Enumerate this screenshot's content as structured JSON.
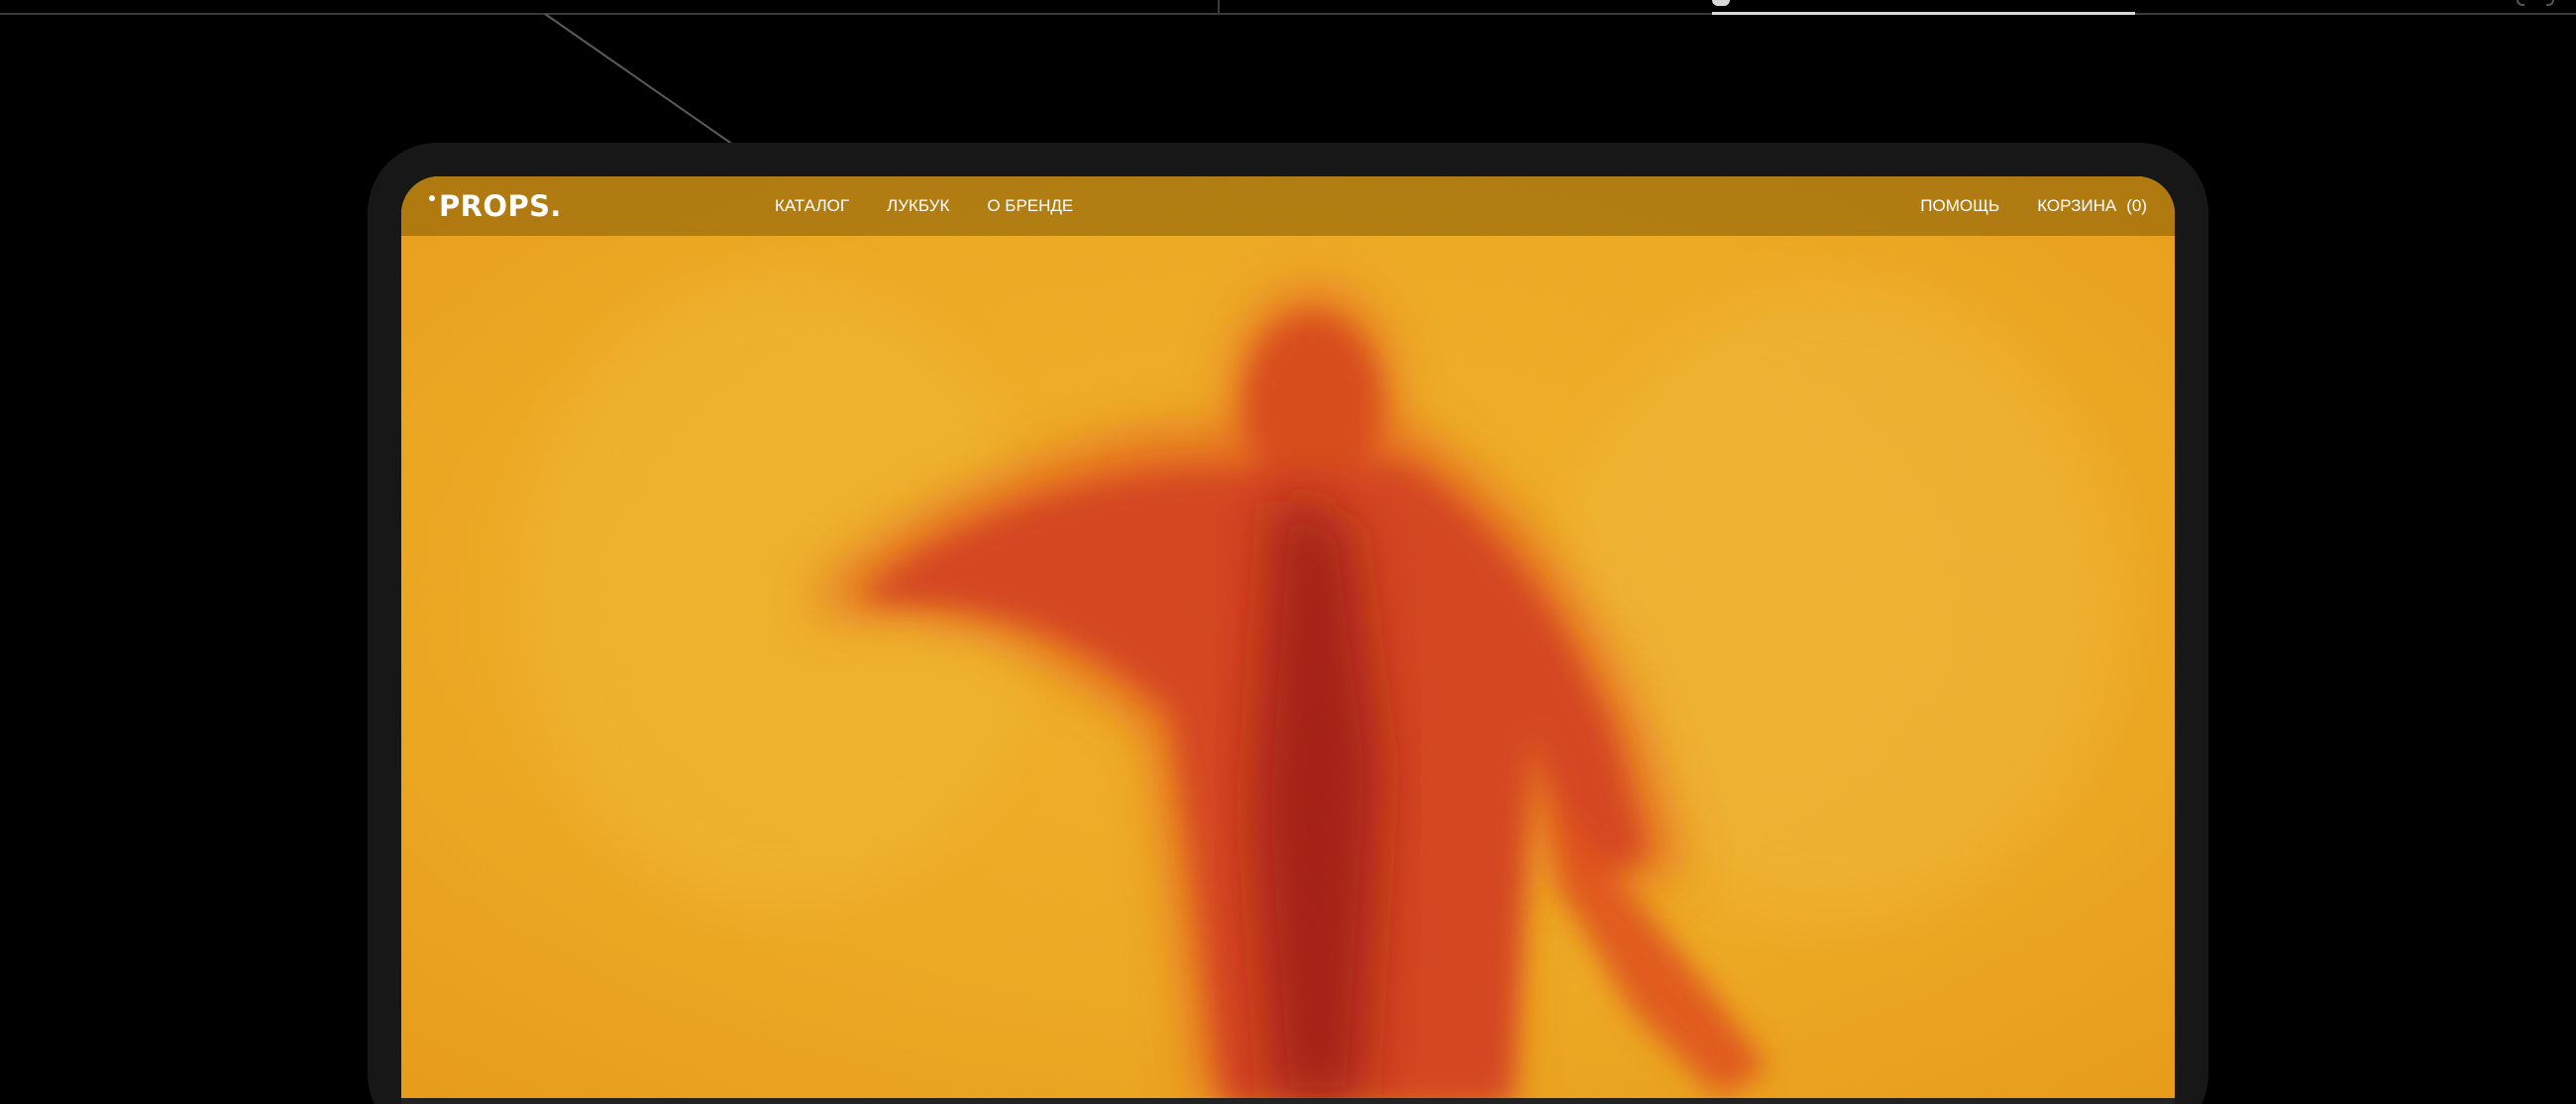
{
  "brand": {
    "logo_text": "PROPS."
  },
  "nav": {
    "left": [
      {
        "label": "КАТАЛОГ"
      },
      {
        "label": "ЛУКБУК"
      },
      {
        "label": "О БРЕНДЕ"
      }
    ],
    "help_label": "ПОМОЩЬ",
    "cart_label": "КОРЗИНА",
    "cart_count": "(0)"
  },
  "hero": {
    "image": "blurred-figure-in-hoodie",
    "colors": {
      "background": "#efac22",
      "figure": "#d13a10",
      "figure_core": "#9a1408"
    }
  },
  "colors": {
    "page_background": "#000000",
    "device_frame": "#171717",
    "nav_overlay": "#8c6208"
  }
}
